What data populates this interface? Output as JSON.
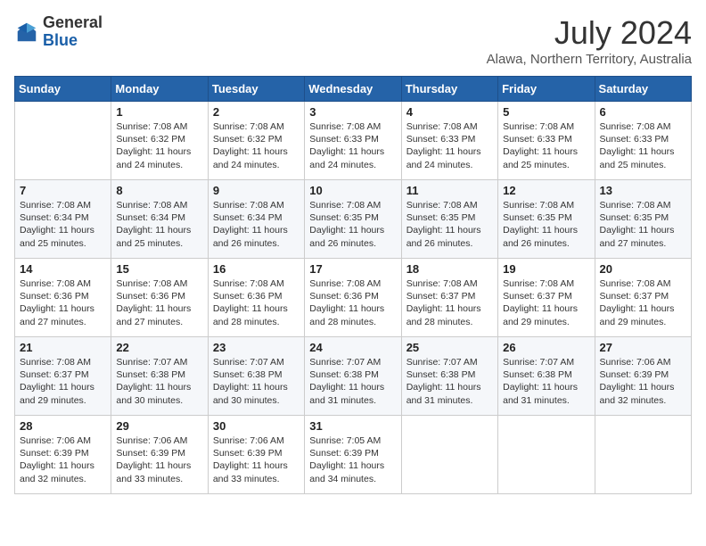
{
  "logo": {
    "general": "General",
    "blue": "Blue"
  },
  "title": {
    "month_year": "July 2024",
    "location": "Alawa, Northern Territory, Australia"
  },
  "days_header": [
    "Sunday",
    "Monday",
    "Tuesday",
    "Wednesday",
    "Thursday",
    "Friday",
    "Saturday"
  ],
  "weeks": [
    [
      {
        "day": "",
        "sunrise": "",
        "sunset": "",
        "daylight": ""
      },
      {
        "day": "1",
        "sunrise": "Sunrise: 7:08 AM",
        "sunset": "Sunset: 6:32 PM",
        "daylight": "Daylight: 11 hours and 24 minutes."
      },
      {
        "day": "2",
        "sunrise": "Sunrise: 7:08 AM",
        "sunset": "Sunset: 6:32 PM",
        "daylight": "Daylight: 11 hours and 24 minutes."
      },
      {
        "day": "3",
        "sunrise": "Sunrise: 7:08 AM",
        "sunset": "Sunset: 6:33 PM",
        "daylight": "Daylight: 11 hours and 24 minutes."
      },
      {
        "day": "4",
        "sunrise": "Sunrise: 7:08 AM",
        "sunset": "Sunset: 6:33 PM",
        "daylight": "Daylight: 11 hours and 24 minutes."
      },
      {
        "day": "5",
        "sunrise": "Sunrise: 7:08 AM",
        "sunset": "Sunset: 6:33 PM",
        "daylight": "Daylight: 11 hours and 25 minutes."
      },
      {
        "day": "6",
        "sunrise": "Sunrise: 7:08 AM",
        "sunset": "Sunset: 6:33 PM",
        "daylight": "Daylight: 11 hours and 25 minutes."
      }
    ],
    [
      {
        "day": "7",
        "sunrise": "Sunrise: 7:08 AM",
        "sunset": "Sunset: 6:34 PM",
        "daylight": "Daylight: 11 hours and 25 minutes."
      },
      {
        "day": "8",
        "sunrise": "Sunrise: 7:08 AM",
        "sunset": "Sunset: 6:34 PM",
        "daylight": "Daylight: 11 hours and 25 minutes."
      },
      {
        "day": "9",
        "sunrise": "Sunrise: 7:08 AM",
        "sunset": "Sunset: 6:34 PM",
        "daylight": "Daylight: 11 hours and 26 minutes."
      },
      {
        "day": "10",
        "sunrise": "Sunrise: 7:08 AM",
        "sunset": "Sunset: 6:35 PM",
        "daylight": "Daylight: 11 hours and 26 minutes."
      },
      {
        "day": "11",
        "sunrise": "Sunrise: 7:08 AM",
        "sunset": "Sunset: 6:35 PM",
        "daylight": "Daylight: 11 hours and 26 minutes."
      },
      {
        "day": "12",
        "sunrise": "Sunrise: 7:08 AM",
        "sunset": "Sunset: 6:35 PM",
        "daylight": "Daylight: 11 hours and 26 minutes."
      },
      {
        "day": "13",
        "sunrise": "Sunrise: 7:08 AM",
        "sunset": "Sunset: 6:35 PM",
        "daylight": "Daylight: 11 hours and 27 minutes."
      }
    ],
    [
      {
        "day": "14",
        "sunrise": "Sunrise: 7:08 AM",
        "sunset": "Sunset: 6:36 PM",
        "daylight": "Daylight: 11 hours and 27 minutes."
      },
      {
        "day": "15",
        "sunrise": "Sunrise: 7:08 AM",
        "sunset": "Sunset: 6:36 PM",
        "daylight": "Daylight: 11 hours and 27 minutes."
      },
      {
        "day": "16",
        "sunrise": "Sunrise: 7:08 AM",
        "sunset": "Sunset: 6:36 PM",
        "daylight": "Daylight: 11 hours and 28 minutes."
      },
      {
        "day": "17",
        "sunrise": "Sunrise: 7:08 AM",
        "sunset": "Sunset: 6:36 PM",
        "daylight": "Daylight: 11 hours and 28 minutes."
      },
      {
        "day": "18",
        "sunrise": "Sunrise: 7:08 AM",
        "sunset": "Sunset: 6:37 PM",
        "daylight": "Daylight: 11 hours and 28 minutes."
      },
      {
        "day": "19",
        "sunrise": "Sunrise: 7:08 AM",
        "sunset": "Sunset: 6:37 PM",
        "daylight": "Daylight: 11 hours and 29 minutes."
      },
      {
        "day": "20",
        "sunrise": "Sunrise: 7:08 AM",
        "sunset": "Sunset: 6:37 PM",
        "daylight": "Daylight: 11 hours and 29 minutes."
      }
    ],
    [
      {
        "day": "21",
        "sunrise": "Sunrise: 7:08 AM",
        "sunset": "Sunset: 6:37 PM",
        "daylight": "Daylight: 11 hours and 29 minutes."
      },
      {
        "day": "22",
        "sunrise": "Sunrise: 7:07 AM",
        "sunset": "Sunset: 6:38 PM",
        "daylight": "Daylight: 11 hours and 30 minutes."
      },
      {
        "day": "23",
        "sunrise": "Sunrise: 7:07 AM",
        "sunset": "Sunset: 6:38 PM",
        "daylight": "Daylight: 11 hours and 30 minutes."
      },
      {
        "day": "24",
        "sunrise": "Sunrise: 7:07 AM",
        "sunset": "Sunset: 6:38 PM",
        "daylight": "Daylight: 11 hours and 31 minutes."
      },
      {
        "day": "25",
        "sunrise": "Sunrise: 7:07 AM",
        "sunset": "Sunset: 6:38 PM",
        "daylight": "Daylight: 11 hours and 31 minutes."
      },
      {
        "day": "26",
        "sunrise": "Sunrise: 7:07 AM",
        "sunset": "Sunset: 6:38 PM",
        "daylight": "Daylight: 11 hours and 31 minutes."
      },
      {
        "day": "27",
        "sunrise": "Sunrise: 7:06 AM",
        "sunset": "Sunset: 6:39 PM",
        "daylight": "Daylight: 11 hours and 32 minutes."
      }
    ],
    [
      {
        "day": "28",
        "sunrise": "Sunrise: 7:06 AM",
        "sunset": "Sunset: 6:39 PM",
        "daylight": "Daylight: 11 hours and 32 minutes."
      },
      {
        "day": "29",
        "sunrise": "Sunrise: 7:06 AM",
        "sunset": "Sunset: 6:39 PM",
        "daylight": "Daylight: 11 hours and 33 minutes."
      },
      {
        "day": "30",
        "sunrise": "Sunrise: 7:06 AM",
        "sunset": "Sunset: 6:39 PM",
        "daylight": "Daylight: 11 hours and 33 minutes."
      },
      {
        "day": "31",
        "sunrise": "Sunrise: 7:05 AM",
        "sunset": "Sunset: 6:39 PM",
        "daylight": "Daylight: 11 hours and 34 minutes."
      },
      {
        "day": "",
        "sunrise": "",
        "sunset": "",
        "daylight": ""
      },
      {
        "day": "",
        "sunrise": "",
        "sunset": "",
        "daylight": ""
      },
      {
        "day": "",
        "sunrise": "",
        "sunset": "",
        "daylight": ""
      }
    ]
  ]
}
